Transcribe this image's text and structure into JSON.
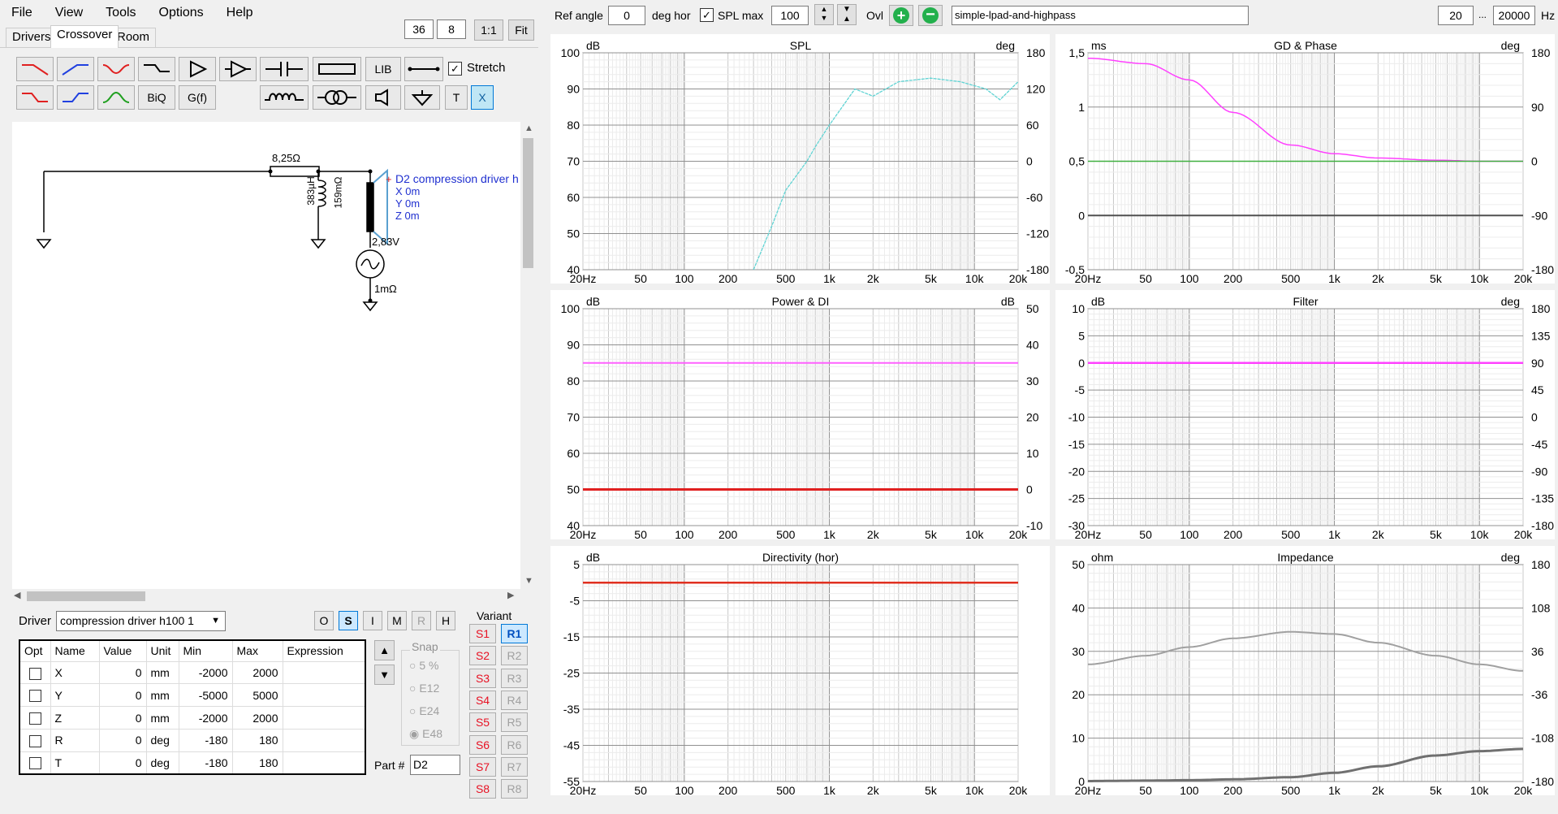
{
  "menu": [
    "File",
    "View",
    "Tools",
    "Options",
    "Help"
  ],
  "tabs": [
    "Drivers",
    "Crossover",
    "Room"
  ],
  "toolbar_top": {
    "num1": "36",
    "num2": "8",
    "one_to_one": "1:1",
    "fit": "Fit"
  },
  "palette": {
    "lib": "LIB",
    "stretch": "Stretch",
    "biq": "BiQ",
    "gf": "G(f)",
    "t": "T",
    "x": "X"
  },
  "schematic": {
    "resistor": "8,25Ω",
    "inductor": "383µH",
    "inductor_r": "159mΩ",
    "driver_name": "D2 compression driver h",
    "driver_x": "X 0m",
    "driver_y": "Y 0m",
    "driver_z": "Z 0m",
    "voltage": "2,83V",
    "source_r": "1mΩ",
    "plus": "+"
  },
  "driver_row": {
    "label": "Driver",
    "value": "compression driver h100 1",
    "modes": [
      "O",
      "S",
      "I",
      "M",
      "R",
      "H"
    ]
  },
  "table": {
    "headers": [
      "Opt",
      "Name",
      "Value",
      "Unit",
      "Min",
      "Max",
      "Expression"
    ],
    "rows": [
      {
        "name": "X",
        "value": "0",
        "unit": "mm",
        "min": "-2000",
        "max": "2000",
        "expr": ""
      },
      {
        "name": "Y",
        "value": "0",
        "unit": "mm",
        "min": "-5000",
        "max": "5000",
        "expr": ""
      },
      {
        "name": "Z",
        "value": "0",
        "unit": "mm",
        "min": "-2000",
        "max": "2000",
        "expr": ""
      },
      {
        "name": "R",
        "value": "0",
        "unit": "deg",
        "min": "-180",
        "max": "180",
        "expr": ""
      },
      {
        "name": "T",
        "value": "0",
        "unit": "deg",
        "min": "-180",
        "max": "180",
        "expr": ""
      }
    ]
  },
  "snap": {
    "title": "Snap",
    "options": [
      "5 %",
      "E12",
      "E24",
      "E48"
    ],
    "selected": "E48"
  },
  "part": {
    "label": "Part #",
    "value": "D2"
  },
  "variant": {
    "title": "Variant",
    "s": [
      "S1",
      "S2",
      "S3",
      "S4",
      "S5",
      "S6",
      "S7",
      "S8"
    ],
    "r": [
      "R1",
      "R2",
      "R3",
      "R4",
      "R5",
      "R6",
      "R7",
      "R8"
    ],
    "selected": "R1"
  },
  "topbar": {
    "ref_angle_label": "Ref angle",
    "ref_angle": "0",
    "deg_hor": "deg hor",
    "spl_max_label": "SPL max",
    "spl_max": "100",
    "ovl": "Ovl",
    "filename": "simple-lpad-and-highpass",
    "f_min": "20",
    "dots": "...",
    "f_max": "20000",
    "hz": "Hz"
  },
  "freq_ticks": [
    "20Hz",
    "50",
    "100",
    "200",
    "500",
    "1k",
    "2k",
    "5k",
    "10k",
    "20k"
  ],
  "charts": {
    "spl": {
      "title": "SPL",
      "left_unit": "dB",
      "right_unit": "deg",
      "left_ticks": [
        "100",
        "90",
        "80",
        "70",
        "60",
        "50",
        "40"
      ],
      "right_ticks": [
        "180",
        "120",
        "60",
        "0",
        "-60",
        "-120",
        "-180"
      ],
      "color": "#5fd3d3"
    },
    "gd": {
      "title": "GD & Phase",
      "left_unit": "ms",
      "right_unit": "deg",
      "left_ticks": [
        "1,5",
        "1",
        "0,5",
        "0",
        "-0,5"
      ],
      "right_ticks": [
        "180",
        "90",
        "0",
        "-90",
        "-180"
      ],
      "color": "#ff40ff"
    },
    "power": {
      "title": "Power & DI",
      "left_unit": "dB",
      "right_unit": "dB",
      "left_ticks": [
        "100",
        "90",
        "80",
        "70",
        "60",
        "50",
        "40"
      ],
      "right_ticks": [
        "50",
        "40",
        "30",
        "20",
        "10",
        "0",
        "-10"
      ],
      "color": "#ff60ff"
    },
    "filter": {
      "title": "Filter",
      "left_unit": "dB",
      "right_unit": "deg",
      "left_ticks": [
        "10",
        "5",
        "0",
        "-5",
        "-10",
        "-15",
        "-20",
        "-25",
        "-30"
      ],
      "right_ticks": [
        "180",
        "135",
        "90",
        "45",
        "0",
        "-45",
        "-90",
        "-135",
        "-180"
      ],
      "color": "#ff40ff"
    },
    "dir": {
      "title": "Directivity (hor)",
      "left_unit": "dB",
      "left_ticks": [
        "5",
        "-5",
        "-15",
        "-25",
        "-35",
        "-45",
        "-55"
      ],
      "color": "#e03020"
    },
    "imp": {
      "title": "Impedance",
      "left_unit": "ohm",
      "right_unit": "deg",
      "left_ticks": [
        "50",
        "40",
        "30",
        "20",
        "10",
        "0"
      ],
      "right_ticks": [
        "180",
        "108",
        "36",
        "-36",
        "-108",
        "-180"
      ],
      "color": "#a0a0a0"
    }
  },
  "chart_data": [
    {
      "type": "line",
      "title": "SPL",
      "ylim": [
        40,
        100
      ],
      "x": [
        300,
        400,
        500,
        700,
        800,
        1000,
        1500,
        2000,
        3000,
        5000,
        8000,
        12000,
        15000,
        20000
      ],
      "series": [
        {
          "values": [
            40,
            52,
            62,
            70,
            74,
            80,
            90,
            88,
            92,
            93,
            92,
            90,
            87,
            92
          ]
        }
      ]
    },
    {
      "type": "line",
      "title": "GD & Phase",
      "ylim": [
        -0.5,
        1.5
      ],
      "x": [
        20,
        50,
        100,
        200,
        500,
        1000,
        2000,
        5000,
        10000,
        20000
      ],
      "series": [
        {
          "values": [
            1.45,
            1.4,
            1.25,
            0.95,
            0.65,
            0.57,
            0.53,
            0.51,
            0.5,
            0.5
          ]
        },
        {
          "values": [
            0.5,
            0.5,
            0.5,
            0.5,
            0.5,
            0.5,
            0.5,
            0.5,
            0.5,
            0.5
          ]
        }
      ]
    },
    {
      "type": "line",
      "title": "Power & DI",
      "ylim": [
        40,
        100
      ],
      "x": [
        20,
        20000
      ],
      "series": [
        {
          "values": [
            85,
            85
          ]
        },
        {
          "values": [
            50,
            50
          ]
        }
      ]
    },
    {
      "type": "line",
      "title": "Filter",
      "ylim": [
        -30,
        10
      ],
      "x": [
        20,
        20000
      ],
      "series": [
        {
          "values": [
            0,
            0
          ]
        }
      ]
    },
    {
      "type": "line",
      "title": "Directivity (hor)",
      "ylim": [
        -55,
        5
      ],
      "x": [
        20,
        20000
      ],
      "series": [
        {
          "values": [
            0,
            0
          ]
        }
      ]
    },
    {
      "type": "line",
      "title": "Impedance",
      "ylim": [
        0,
        50
      ],
      "x": [
        20,
        50,
        100,
        200,
        500,
        1000,
        2000,
        5000,
        10000,
        20000
      ],
      "series": [
        {
          "values": [
            27,
            29,
            31,
            33,
            34.5,
            34,
            32,
            29,
            27,
            25.5
          ]
        },
        {
          "values": [
            0.1,
            0.2,
            0.3,
            0.5,
            1,
            2,
            3.5,
            6,
            7,
            7.5
          ]
        }
      ]
    }
  ]
}
